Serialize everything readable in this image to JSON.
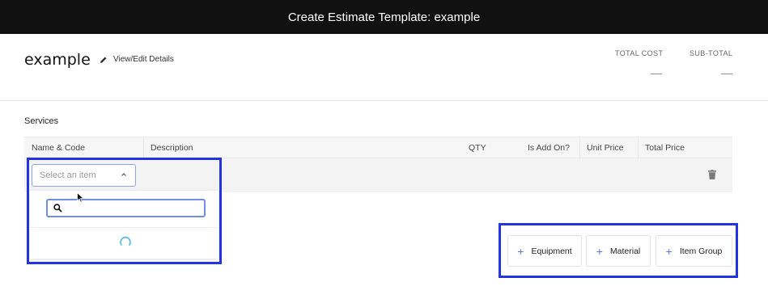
{
  "topbar": {
    "title": "Create Estimate Template: example"
  },
  "header": {
    "page_title": "example",
    "edit_link": "View/Edit Details",
    "stats": [
      {
        "label": "TOTAL COST",
        "value": "—"
      },
      {
        "label": "SUB-TOTAL",
        "value": "—"
      }
    ]
  },
  "services": {
    "label": "Services",
    "columns": [
      "Name & Code",
      "Description",
      "QTY",
      "Is Add On?",
      "Unit Price",
      "Total Price"
    ],
    "row": {
      "select_placeholder": "Select an item"
    }
  },
  "dropdown": {
    "search_placeholder": ""
  },
  "actions": {
    "equipment": "Equipment",
    "material": "Material",
    "item_group": "Item Group"
  },
  "colors": {
    "accent": "#5b7ad8",
    "highlight": "#2433e0",
    "topbar": "#111111"
  }
}
